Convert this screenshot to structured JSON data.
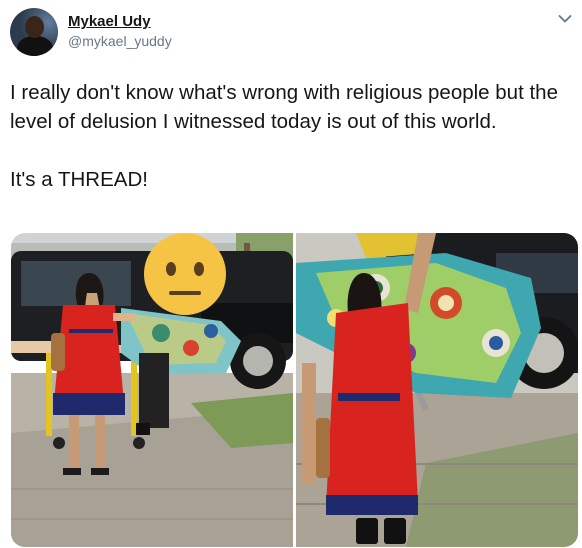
{
  "user": {
    "display_name": "Mykael Udy",
    "handle": "@mykael_yuddy",
    "avatar_icon": "profile-photo"
  },
  "tweet": {
    "text": "I really don't know what's wrong with religious people but the level of delusion I witnessed today is out of this world.\n\nIt's a THREAD!"
  },
  "menu": {
    "icon": "chevron-down-icon"
  },
  "media": {
    "count": 2,
    "photos": [
      {
        "name": "photo-1",
        "description_icon": "neutral-face-emoji"
      },
      {
        "name": "photo-2"
      }
    ]
  },
  "colors": {
    "text": "#14171a",
    "secondary": "#657786",
    "dress": "#d9231f",
    "emoji": "#f6c445"
  }
}
